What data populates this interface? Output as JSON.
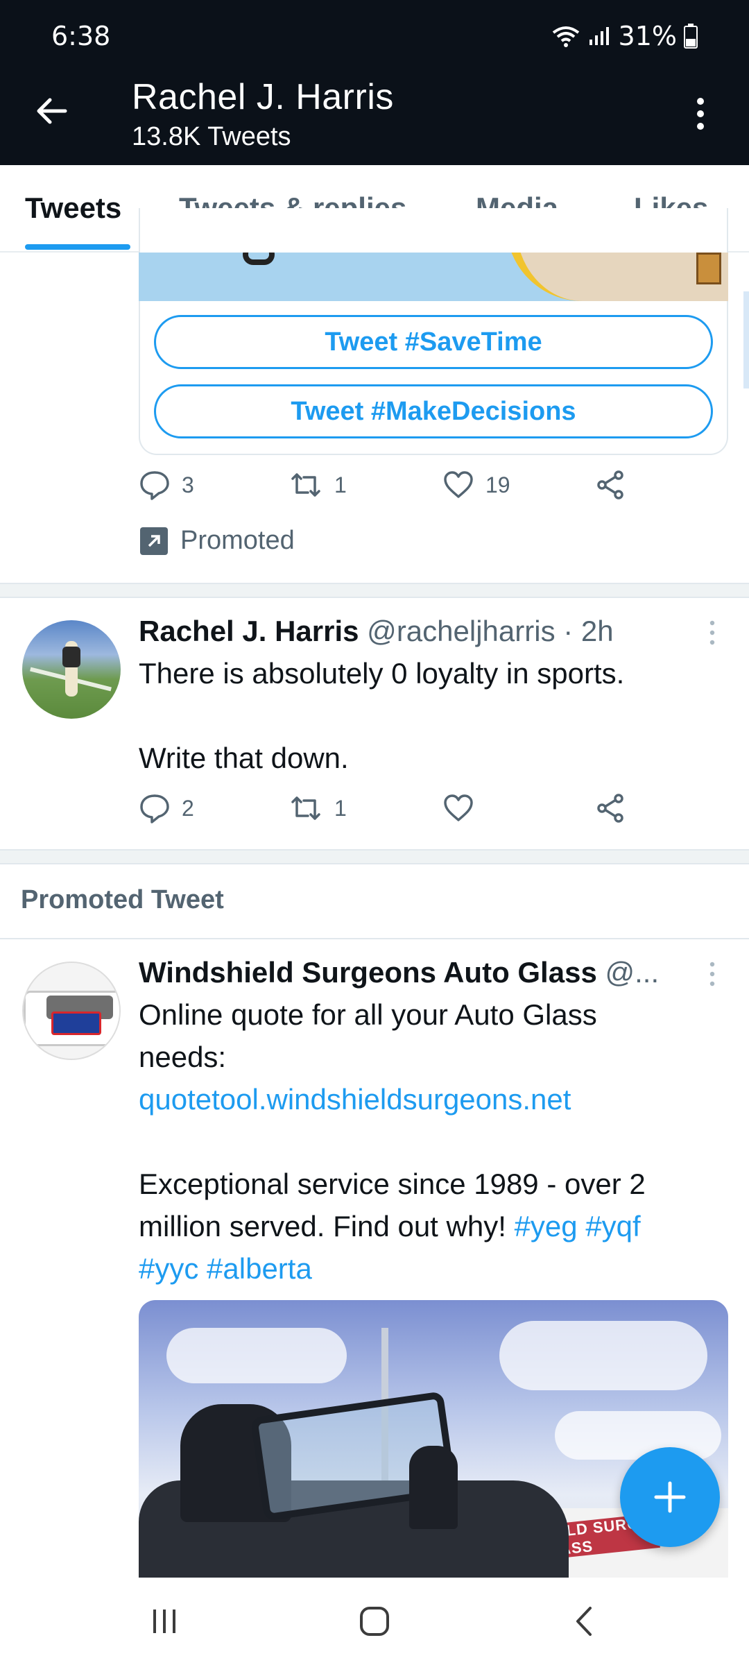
{
  "status_bar": {
    "time": "6:38",
    "battery": "31%"
  },
  "header": {
    "title": "Rachel J. Harris",
    "subtitle": "13.8K Tweets"
  },
  "tabs": [
    {
      "label": "Tweets",
      "active": true
    },
    {
      "label": "Tweets & replies",
      "active": false
    },
    {
      "label": "Media",
      "active": false
    },
    {
      "label": "Likes",
      "active": false
    }
  ],
  "promoted_card": {
    "buttons": [
      "Tweet #SaveTime",
      "Tweet #MakeDecisions"
    ],
    "replies": "3",
    "retweets": "1",
    "likes": "19",
    "promoted_label": "Promoted"
  },
  "tweet_rachel": {
    "name": "Rachel J. Harris",
    "handle_time": " @racheljharris · 2h",
    "line1": "There is absolutely 0 loyalty in sports.",
    "line2": "Write that down.",
    "replies": "2",
    "retweets": "1"
  },
  "promoted_section": {
    "label": "Promoted Tweet"
  },
  "tweet_ws": {
    "name": "Windshield Surgeons Auto Glass",
    "handle": " @...",
    "line1": "Online quote for all your Auto Glass",
    "line2": "needs:",
    "link": "quotetool.windshieldsurgeons.net",
    "line3": "Exceptional service since 1989 - over 2",
    "line4_text": "million served. Find out why! ",
    "tag_yeg": "#yeg",
    "tag_yqf": "#yqf",
    "tag_yyc": "#yyc",
    "tag_alberta": "#alberta",
    "media_van_text": "WINDSHIELD SURG AUTO GLASS"
  },
  "colors": {
    "accent": "#1d9bf0",
    "header_bg": "#0b1119",
    "muted": "#536471"
  },
  "icons": [
    "back-arrow-icon",
    "more-vertical-icon",
    "reply-icon",
    "retweet-icon",
    "like-icon",
    "share-icon",
    "promoted-arrow-icon",
    "compose-plus-icon",
    "recents-icon",
    "home-icon",
    "back-nav-icon",
    "wifi-icon",
    "signal-icon",
    "battery-icon"
  ]
}
